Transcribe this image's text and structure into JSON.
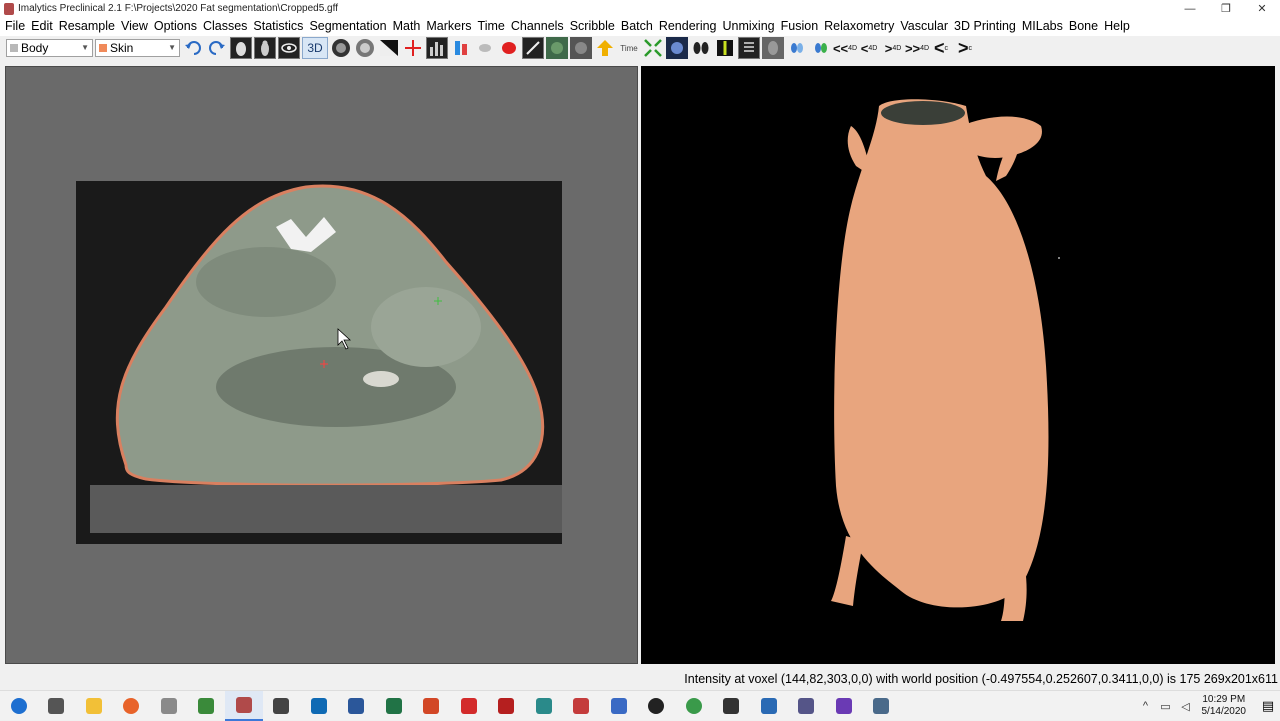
{
  "window": {
    "title": "Imalytics Preclinical 2.1 F:\\Projects\\2020 Fat segmentation\\Cropped5.gff",
    "controls": [
      "—",
      "❐",
      "✕"
    ]
  },
  "menu": [
    "File",
    "Edit",
    "Resample",
    "View",
    "Options",
    "Classes",
    "Statistics",
    "Segmentation",
    "Math",
    "Markers",
    "Time",
    "Channels",
    "Scribble",
    "Batch",
    "Rendering",
    "Unmixing",
    "Fusion",
    "Relaxometry",
    "Vascular",
    "3D Printing",
    "MILabs",
    "Bone",
    "Help"
  ],
  "toolbar": {
    "class_select": {
      "value": "Body",
      "color": "#b8b8b8"
    },
    "sub_class_select": {
      "value": "Skin",
      "color": "#f08a5a"
    },
    "three_d_label": "3D",
    "time_label": "Time",
    "nav": {
      "first4d": "<<",
      "prev4d": "<",
      "next4d": ">",
      "last4d": ">>",
      "sup4d": "4D",
      "prevc": "<",
      "nextc": ">",
      "supc": "c"
    }
  },
  "viewports": {
    "left": {
      "background": "#6a6a6a",
      "contour_color": "#d98060",
      "marker_color": "#ff4040"
    },
    "right": {
      "background": "#000000",
      "surface_color": "#e8a57e"
    }
  },
  "status": {
    "text": "Intensity at voxel (144,82,303,0,0) with world position (-0.497554,0.252607,0.3411,0,0) is 175 269x201x611"
  },
  "taskbar": {
    "clock_time": "10:29 PM",
    "clock_date": "5/14/2020",
    "apps": [
      {
        "name": "start-button",
        "color": "#1e6fd0"
      },
      {
        "name": "task-view",
        "color": "#555555"
      },
      {
        "name": "file-explorer",
        "color": "#f2c037"
      },
      {
        "name": "firefox",
        "color": "#e8632a"
      },
      {
        "name": "app-helper",
        "color": "#8a8a8a"
      },
      {
        "name": "app-green",
        "color": "#3a8a3a"
      },
      {
        "name": "imalytics",
        "color": "#b04a4a"
      },
      {
        "name": "app-teacher",
        "color": "#444444"
      },
      {
        "name": "outlook",
        "color": "#0f6ab4"
      },
      {
        "name": "word",
        "color": "#2b579a"
      },
      {
        "name": "excel",
        "color": "#217346"
      },
      {
        "name": "powerpoint",
        "color": "#d24726"
      },
      {
        "name": "acrobat",
        "color": "#d32b2b"
      },
      {
        "name": "filezilla",
        "color": "#b51f1f"
      },
      {
        "name": "app-teal",
        "color": "#2a8a8a"
      },
      {
        "name": "app-red-box",
        "color": "#c43c3c"
      },
      {
        "name": "app-network",
        "color": "#3a6ac4"
      },
      {
        "name": "obs",
        "color": "#222222"
      },
      {
        "name": "chrome",
        "color": "#3a9a4a"
      },
      {
        "name": "app-dark",
        "color": "#333333"
      },
      {
        "name": "app-bird",
        "color": "#2a6ab4"
      },
      {
        "name": "app-molecule",
        "color": "#555588"
      },
      {
        "name": "visual-studio",
        "color": "#6a3ab4"
      },
      {
        "name": "app-monitor",
        "color": "#4a6a8a"
      }
    ]
  }
}
